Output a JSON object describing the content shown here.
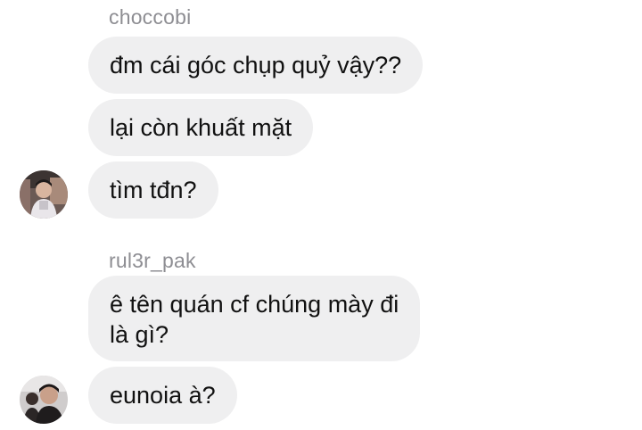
{
  "groups": [
    {
      "username": "choccobi",
      "avatar_icon": "user-avatar-icon",
      "messages": [
        {
          "lines": [
            "đm cái góc chụp quỷ vậy??"
          ]
        },
        {
          "lines": [
            "lại còn khuất mặt"
          ]
        },
        {
          "lines": [
            "tìm tđn?"
          ]
        }
      ]
    },
    {
      "username": "rul3r_pak",
      "avatar_icon": "user-avatar-icon",
      "messages": [
        {
          "lines": [
            "ê tên quán cf chúng mày đi",
            "là gì?"
          ]
        },
        {
          "lines": [
            "eunoia à?"
          ]
        }
      ]
    }
  ],
  "colors": {
    "bubble_bg": "#efeff0",
    "username": "#8e8e93",
    "text": "#111111",
    "background": "#ffffff"
  }
}
